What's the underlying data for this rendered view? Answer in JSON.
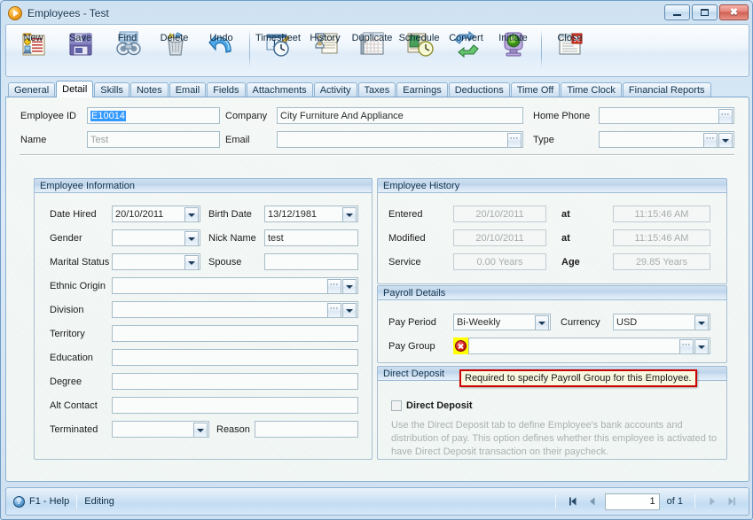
{
  "window": {
    "title": "Employees - Test",
    "title_icon": "play-circle-icon",
    "minimize_label": "Minimize",
    "maximize_label": "Maximize",
    "close_label": "Close"
  },
  "toolbar": {
    "groups": [
      {
        "items": [
          {
            "label": "New",
            "icon": "new-record-icon"
          },
          {
            "label": "Save",
            "icon": "floppy-disk-icon"
          },
          {
            "label": "Find",
            "icon": "binoculars-icon"
          },
          {
            "label": "Delete",
            "icon": "trash-can-icon"
          },
          {
            "label": "Undo",
            "icon": "undo-arrow-icon"
          }
        ]
      },
      {
        "items": [
          {
            "label": "Timesheet",
            "icon": "timesheet-clock-icon"
          },
          {
            "label": "History",
            "icon": "hourglass-history-icon"
          },
          {
            "label": "Duplicate",
            "icon": "duplicate-ledger-icon"
          },
          {
            "label": "Schedule",
            "icon": "schedule-calendar-icon"
          },
          {
            "label": "Convert",
            "icon": "convert-arrows-icon"
          },
          {
            "label": "Initiate",
            "icon": "initiate-light-icon"
          }
        ]
      },
      {
        "items": [
          {
            "label": "Close",
            "icon": "close-document-icon"
          }
        ]
      }
    ]
  },
  "tabs": {
    "active": "Detail",
    "items": [
      "General",
      "Detail",
      "Skills",
      "Notes",
      "Email",
      "Fields",
      "Attachments",
      "Activity",
      "Taxes",
      "Earnings",
      "Deductions",
      "Time Off",
      "Time Clock",
      "Financial Reports"
    ]
  },
  "header_fields": {
    "employee_id_label": "Employee ID",
    "employee_id_value": "E10014",
    "name_label": "Name",
    "name_value": "Test",
    "company_label": "Company",
    "company_value": "City Furniture And Appliance",
    "email_label": "Email",
    "email_value": "",
    "home_phone_label": "Home Phone",
    "home_phone_value": "",
    "type_label": "Type",
    "type_value": ""
  },
  "employee_information": {
    "caption": "Employee Information",
    "date_hired_label": "Date Hired",
    "date_hired_value": "20/10/2011",
    "birth_date_label": "Birth Date",
    "birth_date_value": "13/12/1981",
    "gender_label": "Gender",
    "gender_value": "",
    "nick_name_label": "Nick Name",
    "nick_name_value": "test",
    "marital_status_label": "Marital Status",
    "marital_status_value": "",
    "spouse_label": "Spouse",
    "spouse_value": "",
    "ethnic_origin_label": "Ethnic Origin",
    "ethnic_origin_value": "",
    "division_label": "Division",
    "division_value": "",
    "territory_label": "Territory",
    "territory_value": "",
    "education_label": "Education",
    "education_value": "",
    "degree_label": "Degree",
    "degree_value": "",
    "alt_contact_label": "Alt Contact",
    "alt_contact_value": "",
    "terminated_label": "Terminated",
    "terminated_value": "",
    "reason_label": "Reason",
    "reason_value": ""
  },
  "employee_history": {
    "caption": "Employee History",
    "entered_label": "Entered",
    "entered_date": "20/10/2011",
    "entered_at_label": "at",
    "entered_time": "11:15:46 AM",
    "modified_label": "Modified",
    "modified_date": "20/10/2011",
    "modified_at_label": "at",
    "modified_time": "11:15:46 AM",
    "service_label": "Service",
    "service_value": "0.00 Years",
    "age_label": "Age",
    "age_value": "29.85 Years"
  },
  "payroll_details": {
    "caption": "Payroll Details",
    "pay_period_label": "Pay Period",
    "pay_period_value": "Bi-Weekly",
    "currency_label": "Currency",
    "currency_value": "USD",
    "pay_group_label": "Pay Group",
    "pay_group_value": "",
    "error_icon": "error-x-icon"
  },
  "direct_deposit": {
    "caption": "Direct Deposit",
    "checkbox_label": "Direct Deposit",
    "checked": false,
    "help_text": "Use the Direct Deposit tab to define Employee's bank accounts and distribution of pay. This option defines whether this employee is activated to have Direct Deposit transaction on their paycheck."
  },
  "validation_tooltip": {
    "text": "Required to specify Payroll Group for this Employee.",
    "border_color": "#cc0000",
    "background_color": "#f8f7e0"
  },
  "statusbar": {
    "help_icon": "question-circle-icon",
    "help_label": "F1 - Help",
    "mode_label": "Editing",
    "nav": {
      "first_label": "First record",
      "prev_label": "Previous record",
      "page_value": "1",
      "of_label": "of 1",
      "next_label": "Next record",
      "last_label": "Last record"
    }
  },
  "colors": {
    "accent": "#2f6ca8",
    "error": "#cc0000",
    "highlight": "#ffff00",
    "selection": "#3399ff",
    "frame": "#6f9bc4"
  }
}
